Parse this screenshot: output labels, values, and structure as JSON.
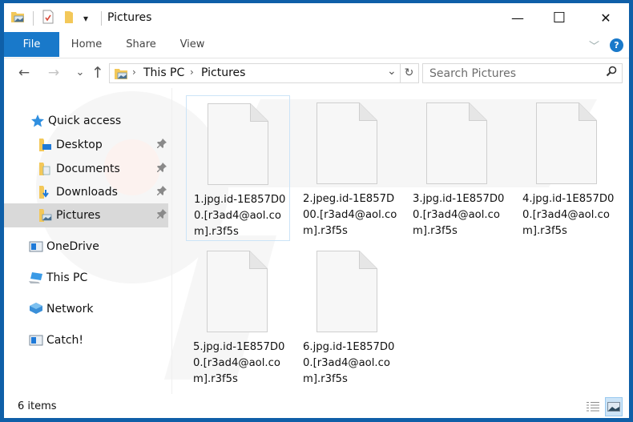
{
  "window": {
    "title": "Pictures",
    "controls": {
      "minimize": "—",
      "maximize": "☐",
      "close": "✕"
    }
  },
  "quick_access_toolbar": {
    "icons": [
      "pictures-folder-icon",
      "properties-icon",
      "new-folder-icon",
      "customize-dropdown-icon"
    ],
    "dropdown_glyph": "▾"
  },
  "ribbon": {
    "tabs": [
      {
        "label": "File",
        "active": true
      },
      {
        "label": "Home"
      },
      {
        "label": "Share"
      },
      {
        "label": "View"
      }
    ],
    "collapse_glyph": "﹀",
    "help_glyph": "?"
  },
  "navigation": {
    "back_glyph": "←",
    "forward_glyph": "→",
    "recent_glyph": "⌄",
    "up_glyph": "↑",
    "breadcrumb": [
      "This PC",
      "Pictures"
    ],
    "separator_glyph": "›",
    "dropdown_glyph": "⌄",
    "refresh_glyph": "↻"
  },
  "search": {
    "placeholder": "Search Pictures",
    "value": "",
    "icon_glyph": "⚲"
  },
  "sidebar": {
    "quick_access_label": "Quick access",
    "pinned": [
      {
        "label": "Desktop",
        "icon": "desktop-folder-icon"
      },
      {
        "label": "Documents",
        "icon": "documents-folder-icon"
      },
      {
        "label": "Downloads",
        "icon": "downloads-folder-icon"
      },
      {
        "label": "Pictures",
        "icon": "pictures-folder-icon",
        "selected": true
      }
    ],
    "pin_glyph": "📌",
    "locations": [
      {
        "label": "OneDrive",
        "icon": "onedrive-icon"
      },
      {
        "label": "This PC",
        "icon": "this-pc-icon"
      },
      {
        "label": "Network",
        "icon": "network-icon"
      },
      {
        "label": "Catch!",
        "icon": "catch-icon"
      }
    ]
  },
  "files": [
    {
      "name": "1.jpg.id-1E857D00.[r3ad4@aol.com].r3f5s",
      "focused": true
    },
    {
      "name": "2.jpeg.id-1E857D00.[r3ad4@aol.com].r3f5s"
    },
    {
      "name": "3.jpg.id-1E857D00.[r3ad4@aol.com].r3f5s"
    },
    {
      "name": "4.jpg.id-1E857D00.[r3ad4@aol.com].r3f5s"
    },
    {
      "name": "5.jpg.id-1E857D00.[r3ad4@aol.com].r3f5s"
    },
    {
      "name": "6.jpg.id-1E857D00.[r3ad4@aol.com].r3f5s"
    }
  ],
  "status_bar": {
    "item_count": "6 items",
    "views": [
      {
        "name": "details-view",
        "active": false
      },
      {
        "name": "large-icons-view",
        "active": true
      }
    ]
  },
  "colors": {
    "accent": "#1979ca",
    "frame": "#0f5fa8",
    "selection": "#d9d9d9",
    "focus_outline": "#cce4f7"
  }
}
